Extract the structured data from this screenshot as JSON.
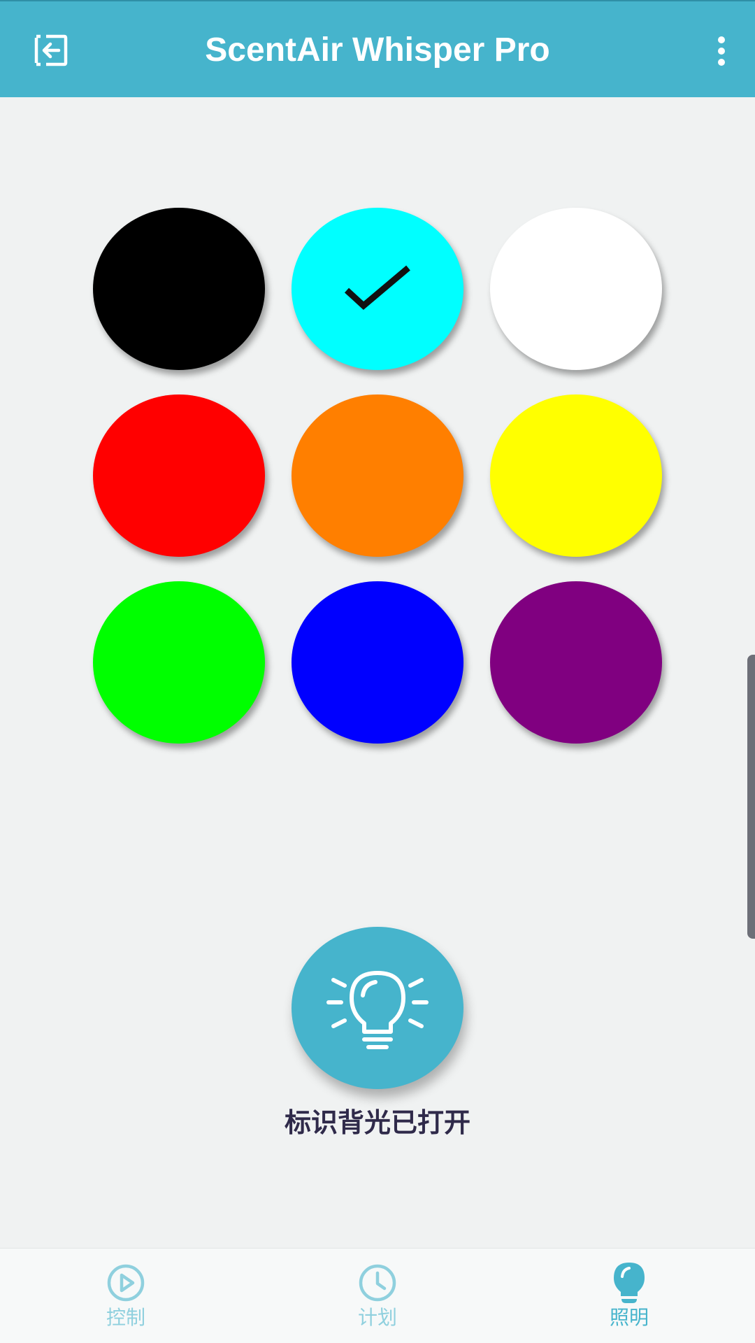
{
  "header": {
    "title": "ScentAir Whisper Pro",
    "back_icon": "exit-arrow-icon",
    "menu_icon": "more-vertical-icon",
    "background": "#46b4cc"
  },
  "colors": {
    "items": [
      {
        "name": "black",
        "hex": "#000000",
        "selected": false
      },
      {
        "name": "cyan",
        "hex": "#00ffff",
        "selected": true
      },
      {
        "name": "white",
        "hex": "#ffffff",
        "selected": false
      },
      {
        "name": "red",
        "hex": "#ff0000",
        "selected": false
      },
      {
        "name": "orange",
        "hex": "#ff7f00",
        "selected": false
      },
      {
        "name": "yellow",
        "hex": "#ffff00",
        "selected": false
      },
      {
        "name": "green",
        "hex": "#00ff00",
        "selected": false
      },
      {
        "name": "blue",
        "hex": "#0000ff",
        "selected": false
      },
      {
        "name": "purple",
        "hex": "#800080",
        "selected": false
      }
    ],
    "check_icon": "checkmark-icon"
  },
  "light": {
    "icon": "lightbulb-icon",
    "status": "标识背光已打开",
    "button_color": "#46b4cc"
  },
  "bottom_nav": {
    "items": [
      {
        "label": "控制",
        "icon": "play-circle-icon",
        "active": false
      },
      {
        "label": "计划",
        "icon": "clock-icon",
        "active": false
      },
      {
        "label": "照明",
        "icon": "lightbulb-icon",
        "active": true
      }
    ],
    "active_color": "#46b4cc",
    "inactive_color": "#8fd0de"
  }
}
